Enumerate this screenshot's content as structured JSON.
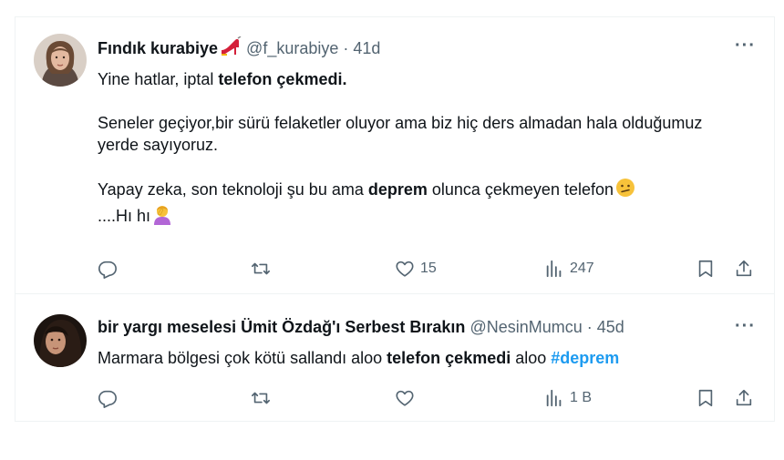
{
  "tweets": [
    {
      "name": "Fındık kurabiye",
      "name_emoji": "high-heel-shoe-emoji",
      "handle": "@f_kurabiye",
      "separator": "·",
      "time": "41d",
      "more_label": "···",
      "body": {
        "p1_a": "Yine hatlar, iptal ",
        "p1_b": "telefon çekmedi.",
        "p2": "Seneler geçiyor,bir sürü felaketler oluyor ama biz hiç ders almadan hala olduğumuz yerde sayıyoruz.",
        "p3_a": "Yapay zeka, son teknoloji şu bu ama ",
        "p3_b": "deprem",
        "p3_c": " olunca çekmeyen telefon",
        "p3_emoji": "confused-face-emoji",
        "p3_d": "....Hı hı",
        "p3_emoji2": "person-facepalming-emoji"
      },
      "actions": {
        "reply_count": "",
        "retweet_count": "",
        "like_count": "15",
        "views_count": "247"
      }
    },
    {
      "name": "bir yargı meselesi Ümit Özdağ'ı Serbest Bırakın",
      "handle": "@NesinMumcu",
      "separator": "·",
      "time": "45d",
      "more_label": "···",
      "body": {
        "a": "Marmara bölgesi çok kötü sallandı aloo ",
        "b": "telefon çekmedi",
        "c": " aloo ",
        "hashtag": "#deprem"
      },
      "actions": {
        "reply_count": "",
        "retweet_count": "",
        "like_count": "",
        "views_count": "1 B"
      }
    }
  ],
  "colors": {
    "text": "#0f1419",
    "secondary": "#536471",
    "link": "#1d9bf0",
    "divider": "#eff3f4"
  }
}
